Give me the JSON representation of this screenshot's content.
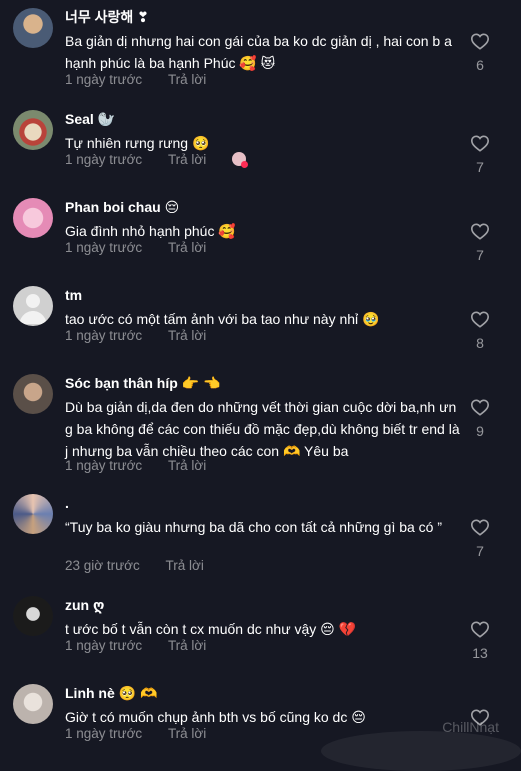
{
  "reply_label": "Trả lời",
  "watermark": "ChillNhạt",
  "comments": [
    {
      "author": "너무 사랑해 ❣",
      "text": "Ba giản dị nhưng hai con gái của ba ko dc giản dị , hai con b a hạnh phúc là ba hạnh Phúc 🥰 😻",
      "time": "1 ngày trước",
      "likes": "6",
      "avatar_color": "#6c7f9a"
    },
    {
      "author": "Seal 🦭",
      "text": "Tự nhiên rưng rưng 🥺",
      "time": "1 ngày trước",
      "likes": "7",
      "avatar_color": "#c7c2b8"
    },
    {
      "author": "Phan boi chau 😔",
      "text": "Gia đình nhỏ hạnh phúc 🥰",
      "time": "1 ngày trước",
      "likes": "7",
      "avatar_color": "#e7a7c5"
    },
    {
      "author": "tm",
      "text": "tao ước có một tấm ảnh với ba tao như này nhỉ 🥹",
      "time": "1 ngày trước",
      "likes": "8",
      "avatar_color": "#c9c9c9"
    },
    {
      "author": "Sóc bạn thân híp 👉 👈",
      "text": "Dù ba giản dị,da đen do những vết thời gian cuộc dời ba,nh ưng ba không để các con thiếu đồ mặc đẹp,dù không biết tr end là j nhưng ba vẫn chiều theo các con 🫶 Yêu ba",
      "time": "1 ngày trước",
      "likes": "9",
      "avatar_color": "#8a8078"
    },
    {
      "author": ".",
      "text": "“Tuy ba ko giàu nhưng ba dã cho con tất cả những gì ba có ”",
      "time": "23 giờ trước",
      "likes": "7",
      "avatar_color": "#9aa6c0"
    },
    {
      "author": "zun ღ",
      "text": "t ước bố t vẫn còn t cx muốn dc như vậy 😔 💔",
      "time": "1 ngày trước",
      "likes": "13",
      "avatar_color": "#2a2a2a"
    },
    {
      "author": "Linh nè 🥺 🫶",
      "text": "Giờ t có muốn chụp ảnh bth vs bố cũng ko dc 😔",
      "time": "1 ngày trước",
      "likes": "",
      "avatar_color": "#d8d3cf"
    }
  ]
}
